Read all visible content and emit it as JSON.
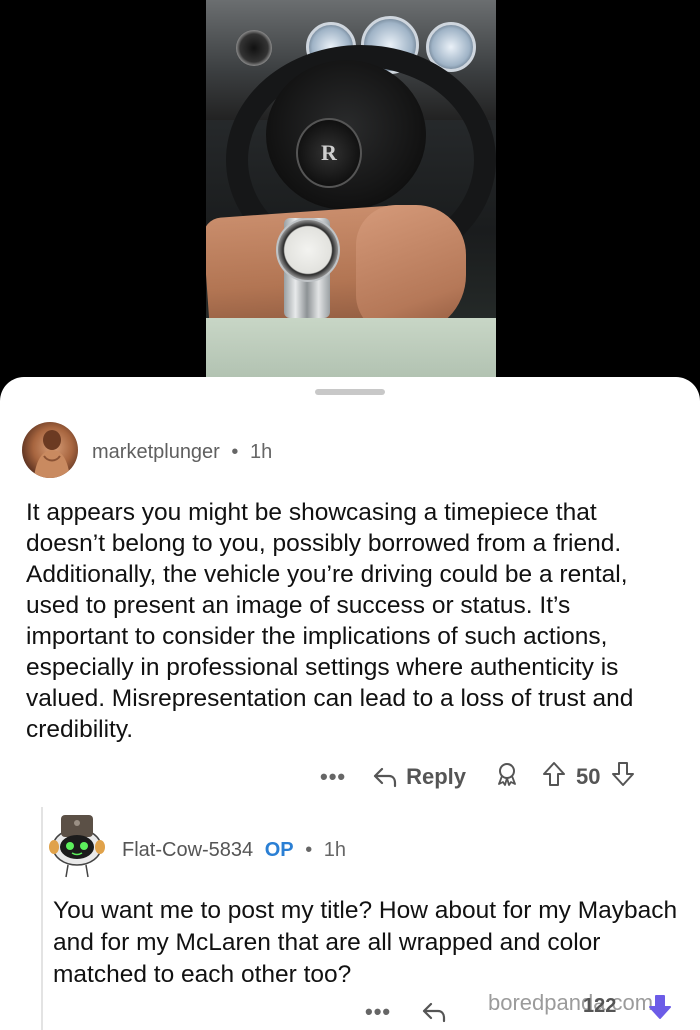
{
  "photo": {
    "badge_text": "R",
    "description_icon": "car-interior-photo"
  },
  "comment1": {
    "username": "marketplunger",
    "separator": "•",
    "time": "1h",
    "text": "It appears you might be showcasing a timepiece that doesn’t belong to you, possibly borrowed from a friend. Additionally, the vehicle you’re driving could be a rental, used to present an image of success or status. It’s important to consider the implications of such actions, especially in professional settings where authenticity is valued. Misrepresentation can lead to a loss of trust and credibility.",
    "more_label": "•••",
    "reply_label": "Reply",
    "vote_count": "50"
  },
  "comment2": {
    "username": "Flat-Cow-5834",
    "op_label": "OP",
    "separator": "•",
    "time": "1h",
    "text": "You want me to post my title? How about for my Maybach and for my McLaren that are all wrapped and color matched to each other too?",
    "more_label": "•••",
    "vote_count": "122"
  },
  "watermark": "boredpanda.com",
  "colors": {
    "accent_blue": "#2a7fd4",
    "downvote_active": "#6c5ce7",
    "text_primary": "#111111",
    "text_secondary": "#555555"
  }
}
